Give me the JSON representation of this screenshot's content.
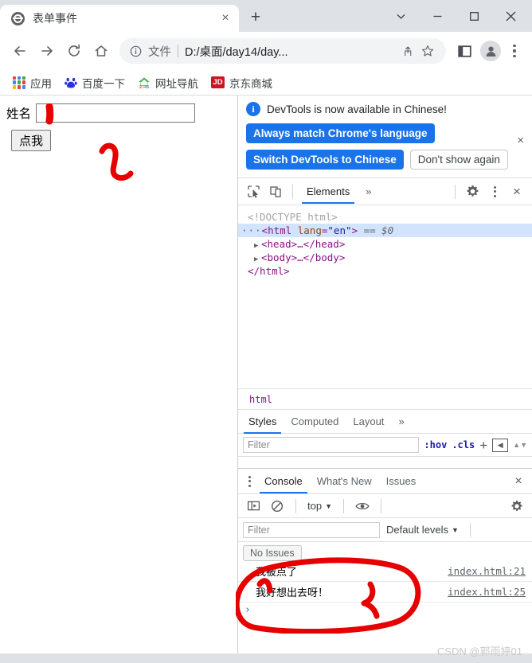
{
  "window": {
    "controls": [
      "tab-search",
      "minimize",
      "maximize",
      "close"
    ]
  },
  "tab": {
    "title": "表单事件",
    "close_label": "×",
    "new_tab_label": "+"
  },
  "toolbar": {
    "back": "←",
    "forward": "→",
    "reload": "↻",
    "home": "⌂",
    "omnibox": {
      "scheme_label": "文件",
      "url": "D:/桌面/day14/day...",
      "share_icon": "share-icon",
      "star_icon": "star-icon"
    },
    "side_panel_icon": "side-panel-icon",
    "profile_icon": "profile-avatar",
    "menu_icon": "three-dot-menu"
  },
  "bookmarks": [
    {
      "label": "应用",
      "icon": "apps-grid-icon"
    },
    {
      "label": "百度一下",
      "icon": "baidu-icon"
    },
    {
      "label": "网址导航",
      "icon": "2345-icon"
    },
    {
      "label": "京东商城",
      "icon": "jd-icon",
      "badge": "JD"
    }
  ],
  "page": {
    "form": {
      "label": "姓名",
      "input_value": "",
      "input_placeholder": "",
      "button_label": "点我"
    }
  },
  "devtools": {
    "banner": {
      "message": "DevTools is now available in Chinese!",
      "primary_button": "Always match Chrome's language",
      "secondary_button": "Switch DevTools to Chinese",
      "dismiss_button": "Don't show again",
      "close_label": "×"
    },
    "toolbar": {
      "inspect_icon": "inspect-element-icon",
      "device_icon": "device-toolbar-icon",
      "tabs": [
        {
          "label": "Elements",
          "active": true
        },
        {
          "label": "»",
          "active": false
        }
      ],
      "settings_icon": "gear-icon",
      "more_icon": "three-dot-menu",
      "close_label": "×"
    },
    "dom": {
      "doctype": "<!DOCTYPE html>",
      "html_open_tag": "<html",
      "html_attr_name": "lang",
      "html_attr_value": "\"en\"",
      "html_close_bracket": ">",
      "selected_marker": "== $0",
      "head_line": "<head>…</head>",
      "body_line": "<body>…</body>",
      "html_close": "</html>"
    },
    "breadcrumb": [
      "html"
    ],
    "styles": {
      "tabs": [
        {
          "label": "Styles",
          "active": true
        },
        {
          "label": "Computed",
          "active": false
        },
        {
          "label": "Layout",
          "active": false
        },
        {
          "label": "»",
          "active": false
        }
      ],
      "filter_placeholder": "Filter",
      "hov_label": ":hov",
      "cls_label": ".cls",
      "add_rule_label": "+",
      "sidebar_toggle_icon": "sidebar-toggle-icon"
    },
    "drawer": {
      "tabs": [
        {
          "label": "Console",
          "active": true
        },
        {
          "label": "What's New",
          "active": false
        },
        {
          "label": "Issues",
          "active": false
        }
      ],
      "close_label": "×",
      "console_toolbar": {
        "sidebar_icon": "console-sidebar-icon",
        "clear_icon": "clear-console-icon",
        "context": "top",
        "eye_icon": "live-expression-icon",
        "settings_icon": "gear-icon"
      },
      "filter_placeholder": "Filter",
      "levels_label": "Default levels",
      "issues_button": "No Issues",
      "messages": [
        {
          "text": "我被点了",
          "source": "index.html:21"
        },
        {
          "text": "我好想出去呀！",
          "source": "index.html:25"
        }
      ],
      "prompt_symbol": "›"
    }
  },
  "watermark": "CSDN @郭雨婷01",
  "colors": {
    "chrome_frame": "#dee1e6",
    "accent_blue": "#1a73e8",
    "ink_red": "#e60000",
    "jd_red": "#c81623"
  }
}
